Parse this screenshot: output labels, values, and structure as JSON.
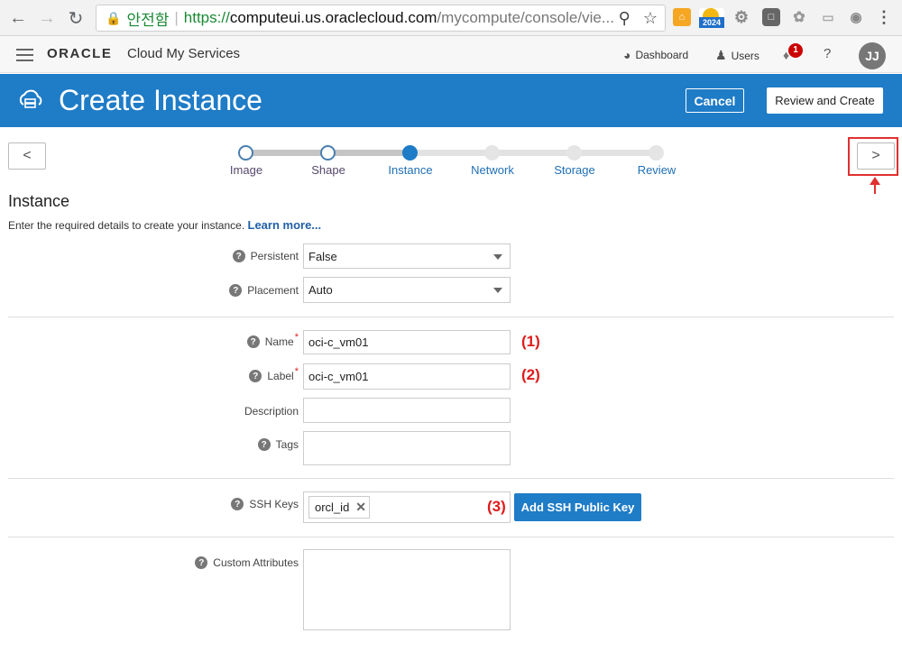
{
  "browser": {
    "secure_label": "안전함",
    "url_scheme": "https://",
    "url_host": "computeui.us.oraclecloud.com",
    "url_path": "/mycompute/console/vie...",
    "calendar_year": "2024"
  },
  "header": {
    "brand": "ORACLE",
    "product": "Cloud My Services",
    "dashboard_label": "Dashboard",
    "users_label": "Users",
    "notification_count": "1",
    "help_label": "?",
    "avatar_initials": "JJ"
  },
  "title_bar": {
    "title": "Create Instance",
    "cancel_label": "Cancel",
    "review_label": "Review and Create"
  },
  "train": {
    "prev_label": "<",
    "next_label": ">",
    "steps": [
      {
        "label": "Image",
        "state": "done"
      },
      {
        "label": "Shape",
        "state": "done"
      },
      {
        "label": "Instance",
        "state": "current"
      },
      {
        "label": "Network",
        "state": "todo"
      },
      {
        "label": "Storage",
        "state": "todo"
      },
      {
        "label": "Review",
        "state": "todo"
      }
    ]
  },
  "form": {
    "section_title": "Instance",
    "intro_text": "Enter the required details to create your instance.",
    "learn_more": "Learn more...",
    "persistent": {
      "label": "Persistent",
      "value": "False"
    },
    "placement": {
      "label": "Placement",
      "value": "Auto"
    },
    "name": {
      "label": "Name",
      "required_mark": "*",
      "value": "oci-c_vm01",
      "annotation": "(1)"
    },
    "label_field": {
      "label": "Label",
      "required_mark": "*",
      "value": "oci-c_vm01",
      "annotation": "(2)"
    },
    "description": {
      "label": "Description",
      "value": ""
    },
    "tags": {
      "label": "Tags",
      "value": ""
    },
    "ssh_keys": {
      "label": "SSH Keys",
      "chip": "orcl_id",
      "chip_remove": "✕",
      "annotation": "(3)",
      "add_button": "Add SSH Public Key"
    },
    "custom_attributes": {
      "label": "Custom Attributes",
      "value": ""
    }
  },
  "colors": {
    "brand_blue": "#1f7cc7",
    "annotation_red": "#e01a1a"
  }
}
